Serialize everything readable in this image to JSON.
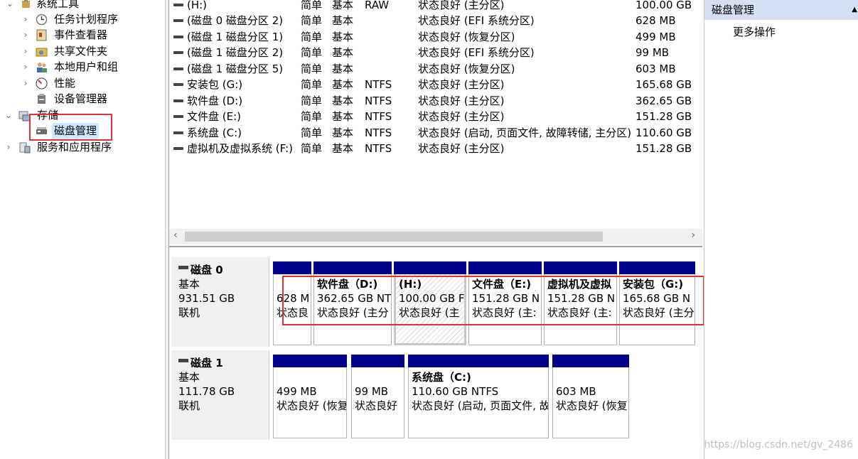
{
  "tree": {
    "items": [
      {
        "label": "系统工具",
        "arrow": "⌄",
        "icon": "tools-icon"
      },
      {
        "label": "任务计划程序",
        "arrow": "›",
        "icon": "clock-icon"
      },
      {
        "label": "事件查看器",
        "arrow": "›",
        "icon": "event-viewer-icon"
      },
      {
        "label": "共享文件夹",
        "arrow": "›",
        "icon": "shared-folder-icon"
      },
      {
        "label": "本地用户和组",
        "arrow": "›",
        "icon": "users-icon"
      },
      {
        "label": "性能",
        "arrow": "›",
        "icon": "performance-icon"
      },
      {
        "label": "设备管理器",
        "arrow": "",
        "icon": "device-manager-icon"
      },
      {
        "label": "存储",
        "arrow": "⌄",
        "icon": "storage-icon"
      },
      {
        "label": "磁盘管理",
        "arrow": "",
        "icon": "disk-management-icon"
      },
      {
        "label": "服务和应用程序",
        "arrow": "›",
        "icon": "services-icon"
      }
    ]
  },
  "volumes": {
    "rows": [
      {
        "name": "(H:)",
        "layout": "简单",
        "type": "基本",
        "fs": "RAW",
        "status": "状态良好 (主分区)",
        "capacity": "100.00 GB"
      },
      {
        "name": "(磁盘 0 磁盘分区 2)",
        "layout": "简单",
        "type": "基本",
        "fs": "",
        "status": "状态良好 (EFI 系统分区)",
        "capacity": "628 MB"
      },
      {
        "name": "(磁盘 1 磁盘分区 1)",
        "layout": "简单",
        "type": "基本",
        "fs": "",
        "status": "状态良好 (恢复分区)",
        "capacity": "499 MB"
      },
      {
        "name": "(磁盘 1 磁盘分区 2)",
        "layout": "简单",
        "type": "基本",
        "fs": "",
        "status": "状态良好 (EFI 系统分区)",
        "capacity": "99 MB"
      },
      {
        "name": "(磁盘 1 磁盘分区 5)",
        "layout": "简单",
        "type": "基本",
        "fs": "",
        "status": "状态良好 (恢复分区)",
        "capacity": "603 MB"
      },
      {
        "name": "安装包 (G:)",
        "layout": "简单",
        "type": "基本",
        "fs": "NTFS",
        "status": "状态良好 (主分区)",
        "capacity": "165.68 GB"
      },
      {
        "name": "软件盘 (D:)",
        "layout": "简单",
        "type": "基本",
        "fs": "NTFS",
        "status": "状态良好 (主分区)",
        "capacity": "362.65 GB"
      },
      {
        "name": "文件盘 (E:)",
        "layout": "简单",
        "type": "基本",
        "fs": "NTFS",
        "status": "状态良好 (主分区)",
        "capacity": "151.28 GB"
      },
      {
        "name": "系统盘 (C:)",
        "layout": "简单",
        "type": "基本",
        "fs": "NTFS",
        "status": "状态良好 (启动, 页面文件, 故障转储, 主分区)",
        "capacity": "110.60 GB"
      },
      {
        "name": "虚拟机及虚拟系统 (F:)",
        "layout": "简单",
        "type": "基本",
        "fs": "NTFS",
        "status": "状态良好 (主分区)",
        "capacity": "151.28 GB"
      }
    ]
  },
  "disks": [
    {
      "title": "磁盘 0",
      "type": "基本",
      "size": "931.51 GB",
      "state": "联机",
      "partitions": [
        {
          "name": "",
          "size": "628 M",
          "status": "状态良"
        },
        {
          "name": "软件盘（D:)",
          "size": "362.65 GB NT",
          "status": "状态良好 (主分"
        },
        {
          "name": "(H:)",
          "size": "100.00 GB F",
          "status": "状态良好 (主"
        },
        {
          "name": "文件盘（E:)",
          "size": "151.28 GB N",
          "status": "状态良好 (主:"
        },
        {
          "name": "虚拟机及虚拟",
          "size": "151.28 GB N",
          "status": "状态良好 (主:"
        },
        {
          "name": "安装包（G:)",
          "size": "165.68 GB N",
          "status": "状态良好 (主分"
        }
      ]
    },
    {
      "title": "磁盘 1",
      "type": "基本",
      "size": "111.78 GB",
      "state": "联机",
      "partitions": [
        {
          "name": "",
          "size": "499 MB",
          "status": "状态良好 (恢复"
        },
        {
          "name": "",
          "size": "99 MB",
          "status": "状态良好"
        },
        {
          "name": "系统盘（C:)",
          "size": "110.60 GB NTFS",
          "status": "状态良好 (启动, 页面文件, 故"
        },
        {
          "name": "",
          "size": "603 MB",
          "status": "状态良好 (恢复"
        }
      ]
    }
  ],
  "actions": {
    "header": "磁盘管理",
    "more": "更多操作"
  },
  "watermark": "https://blog.csdn.net/gv_2486",
  "colors": {
    "partition_bar": "#00008b",
    "selection": "#cce8ff",
    "highlight_box": "#e0303a",
    "action_header": "#d5e1f2"
  }
}
